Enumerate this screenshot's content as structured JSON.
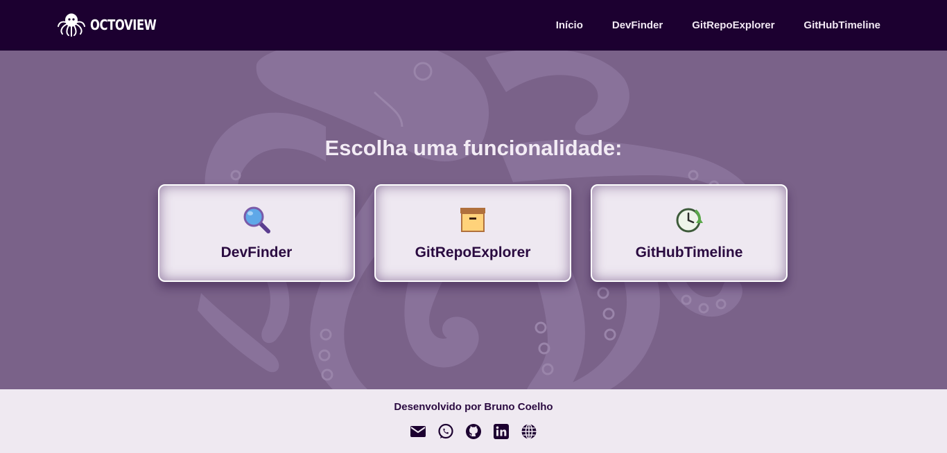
{
  "header": {
    "logo_text": "OCTOVIEW",
    "nav": [
      {
        "label": "Início"
      },
      {
        "label": "DevFinder"
      },
      {
        "label": "GitRepoExplorer"
      },
      {
        "label": "GitHubTimeline"
      }
    ]
  },
  "main": {
    "title": "Escolha uma funcionalidade:",
    "cards": [
      {
        "label": "DevFinder",
        "icon": "magnifying-glass-icon"
      },
      {
        "label": "GitRepoExplorer",
        "icon": "archive-box-icon"
      },
      {
        "label": "GitHubTimeline",
        "icon": "clock-history-icon"
      }
    ]
  },
  "footer": {
    "credit": "Desenvolvido por Bruno Coelho",
    "social": [
      "envelope-icon",
      "whatsapp-icon",
      "github-icon",
      "linkedin-icon",
      "globe-icon"
    ]
  },
  "colors": {
    "header_bg": "#1c0030",
    "hero_bg": "#7a6289",
    "card_bg": "#eee8f1",
    "footer_bg": "#efe9f1",
    "accent_text": "#2a0a40"
  }
}
